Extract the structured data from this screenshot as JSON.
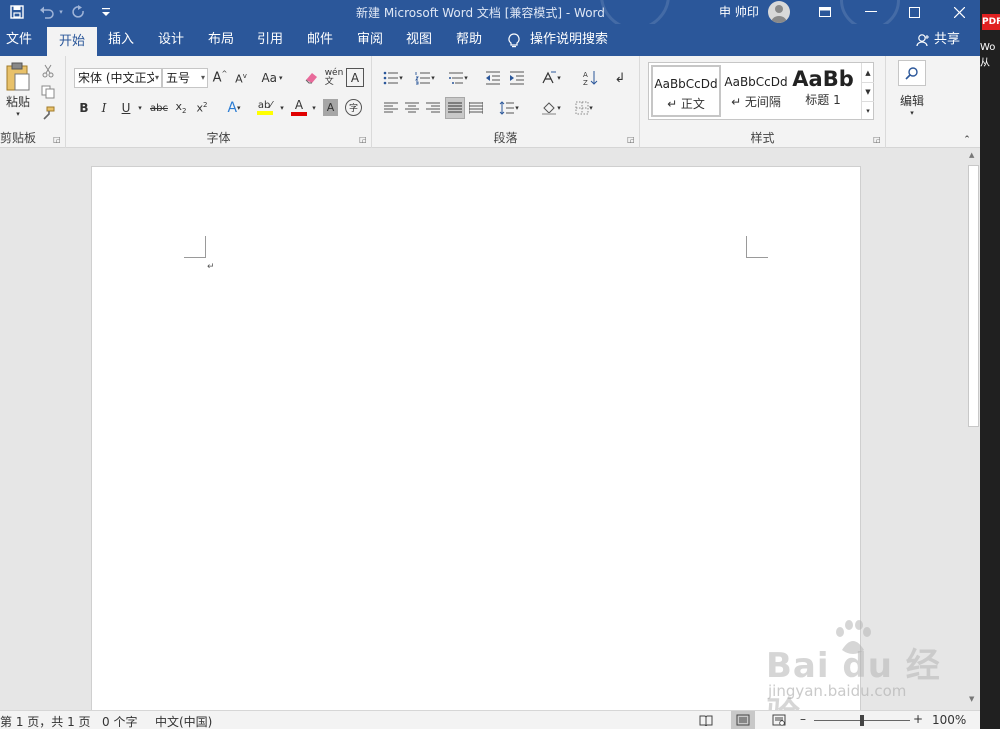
{
  "window": {
    "title": "新建 Microsoft Word 文档 [兼容模式]  -  Word",
    "user_name": "申 帅印"
  },
  "tabs": [
    {
      "label": "文件"
    },
    {
      "label": "开始"
    },
    {
      "label": "插入"
    },
    {
      "label": "设计"
    },
    {
      "label": "布局"
    },
    {
      "label": "引用"
    },
    {
      "label": "邮件"
    },
    {
      "label": "审阅"
    },
    {
      "label": "视图"
    },
    {
      "label": "帮助"
    }
  ],
  "tell_me": "操作说明搜索",
  "share_label": "共享",
  "ribbon": {
    "clipboard": {
      "paste_label": "粘贴",
      "group_label": "剪贴板"
    },
    "font": {
      "font_name": "宋体 (中文正文",
      "font_size": "五号",
      "change_case": "Aa",
      "group_label": "字体",
      "highlight_color": "#ffff00",
      "font_color": "#e00000"
    },
    "paragraph": {
      "group_label": "段落"
    },
    "styles": {
      "group_label": "样式",
      "items": [
        {
          "sample": "AaBbCcDd",
          "name": "↵ 正文"
        },
        {
          "sample": "AaBbCcDd",
          "name": "↵ 无间隔"
        },
        {
          "sample": "AaBb",
          "name": "标题 1"
        }
      ]
    },
    "editing": {
      "label": "编辑"
    }
  },
  "document": {
    "paragraph_mark": "↵"
  },
  "status": {
    "page_info": "第 1 页，共 1 页",
    "word_count": "0 个字",
    "language": "中文(中国)",
    "zoom": "100%",
    "zoom_level": 1.0
  },
  "side_panel": {
    "pdf_label": "PDF",
    "text1": "Wo",
    "text2": "从"
  },
  "watermark": {
    "brand": "Bai du 经验",
    "url": "jingyan.baidu.com"
  },
  "colors": {
    "accent": "#2b579a",
    "ribbon_bg": "#f3f3f3",
    "canvas_bg": "#e6e6e6"
  }
}
